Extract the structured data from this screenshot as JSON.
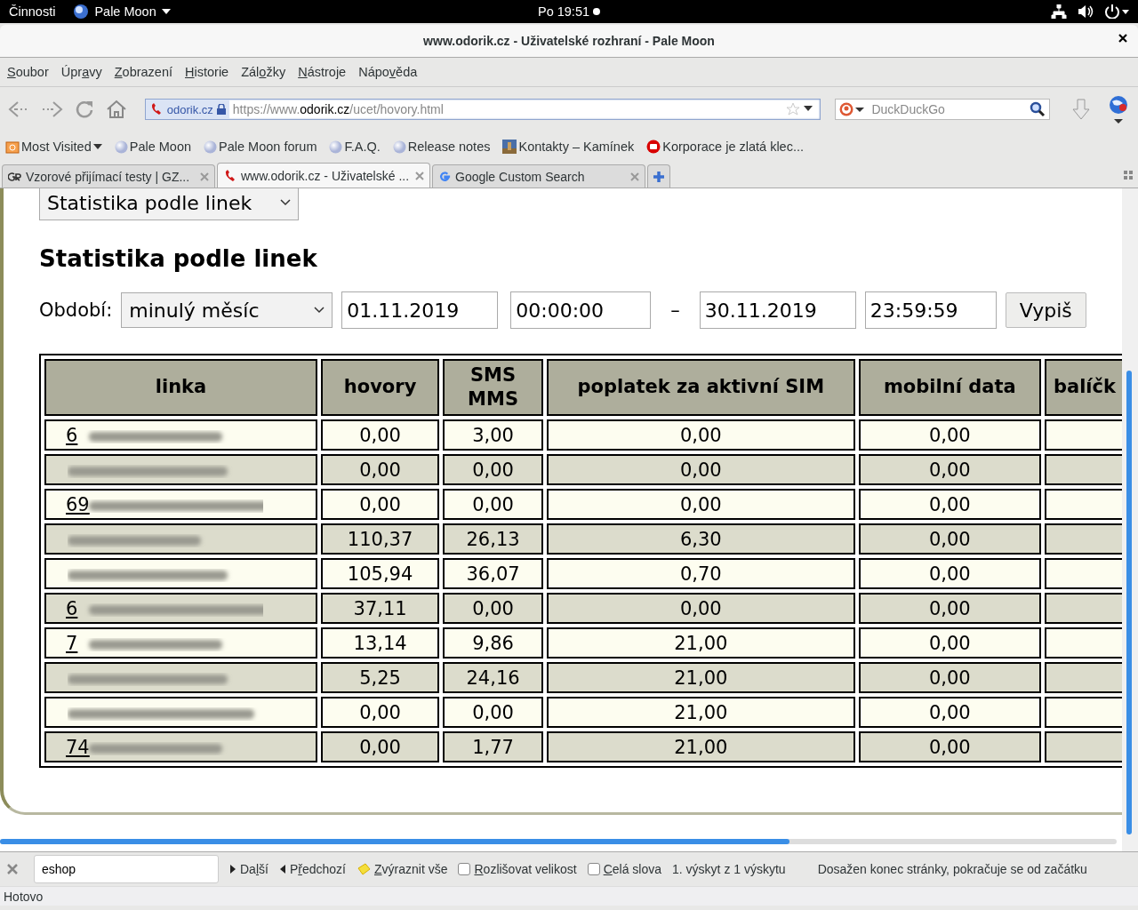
{
  "top_bar": {
    "activities": "Činnosti",
    "app_menu": "Pale Moon",
    "clock": "Po 19:51"
  },
  "window": {
    "title": "www.odorik.cz - Uživatelské rozhraní - Pale Moon"
  },
  "menu": [
    {
      "label": "Soubor"
    },
    {
      "label": "Úpravy"
    },
    {
      "label": "Zobrazení"
    },
    {
      "label": "Historie"
    },
    {
      "label": "Záložky"
    },
    {
      "label": "Nástroje"
    },
    {
      "label": "Nápověda"
    }
  ],
  "address": {
    "site": "odorik.cz",
    "url_prefix": "https://www.",
    "url_domain": "odorik.cz",
    "url_path": "/ucet/hovory.html"
  },
  "search": {
    "placeholder": "DuckDuckGo"
  },
  "bookmarks": [
    {
      "label": "Most Visited",
      "kind": "folder"
    },
    {
      "label": "Pale Moon",
      "kind": "globe"
    },
    {
      "label": "Pale Moon forum",
      "kind": "globe"
    },
    {
      "label": "F.A.Q.",
      "kind": "globe"
    },
    {
      "label": "Release notes",
      "kind": "globe"
    },
    {
      "label": "Kontakty – Kamínek"
    },
    {
      "label": "Korporace je zlatá klec...",
      "kind": "red"
    }
  ],
  "tabs": [
    {
      "label": "Vzorové přijímací testy | GZ...",
      "selected": false
    },
    {
      "label": "www.odorik.cz - Uživatelské ...",
      "selected": true
    },
    {
      "label": "Google Custom Search",
      "selected": false
    }
  ],
  "page": {
    "view_select": "Statistika podle linek",
    "heading": "Statistika podle linek",
    "period_label": "Období:",
    "period_select": "minulý měsíc",
    "date_from": "01.11.2019",
    "time_from": "00:00:00",
    "dash": "–",
    "date_to": "30.11.2019",
    "time_to": "23:59:59",
    "submit": "Vypiš"
  },
  "table": {
    "columns": [
      "linka",
      "hovory",
      "SMS MMS",
      "poplatek za aktivní SIM",
      "mobilní data",
      "balíčk"
    ],
    "rows": [
      {
        "linka": "6",
        "hovory": "0,00",
        "sms": "3,00",
        "poplatek": "0,00",
        "data": "0,00"
      },
      {
        "hovory": "0,00",
        "sms": "0,00",
        "poplatek": "0,00",
        "data": "0,00"
      },
      {
        "linka": "69",
        "hovory": "0,00",
        "sms": "0,00",
        "poplatek": "0,00",
        "data": "0,00"
      },
      {
        "hovory": "110,37",
        "sms": "26,13",
        "poplatek": "6,30",
        "data": "0,00"
      },
      {
        "hovory": "105,94",
        "sms": "36,07",
        "poplatek": "0,70",
        "data": "0,00"
      },
      {
        "linka": "6",
        "hovory": "37,11",
        "sms": "0,00",
        "poplatek": "0,00",
        "data": "0,00"
      },
      {
        "linka": "7",
        "hovory": "13,14",
        "sms": "9,86",
        "poplatek": "21,00",
        "data": "0,00"
      },
      {
        "hovory": "5,25",
        "sms": "24,16",
        "poplatek": "21,00",
        "data": "0,00"
      },
      {
        "hovory": "0,00",
        "sms": "0,00",
        "poplatek": "21,00",
        "data": "0,00"
      },
      {
        "linka": "74",
        "hovory": "0,00",
        "sms": "1,77",
        "poplatek": "21,00",
        "data": "0,00"
      }
    ]
  },
  "find_bar": {
    "value": "eshop",
    "next": "Další",
    "prev": "Předchozí",
    "highlight": "Zvýraznit vše",
    "options": [
      {
        "label": "Rozlišovat velikost",
        "checked": false
      },
      {
        "label": "Celá slova",
        "checked": false
      }
    ],
    "count": "1. výskyt z 1 výskytu",
    "message": "Dosažen konec stránky, pokračuje se od začátku"
  },
  "status_bar": "Hotovo"
}
